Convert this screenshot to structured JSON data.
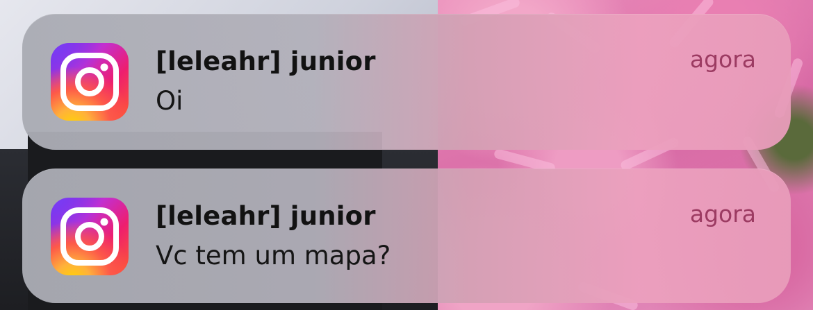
{
  "notifications": [
    {
      "app_icon": "instagram-icon",
      "sender": "[leleahr] junior",
      "message": "Oi",
      "time": "agora"
    },
    {
      "app_icon": "instagram-icon",
      "sender": "[leleahr] junior",
      "message": "Vc tem um mapa?",
      "time": "agora"
    }
  ],
  "colors": {
    "timestamp": "#9c3b62",
    "text": "#121212",
    "accent_pink": "#e98cba"
  }
}
